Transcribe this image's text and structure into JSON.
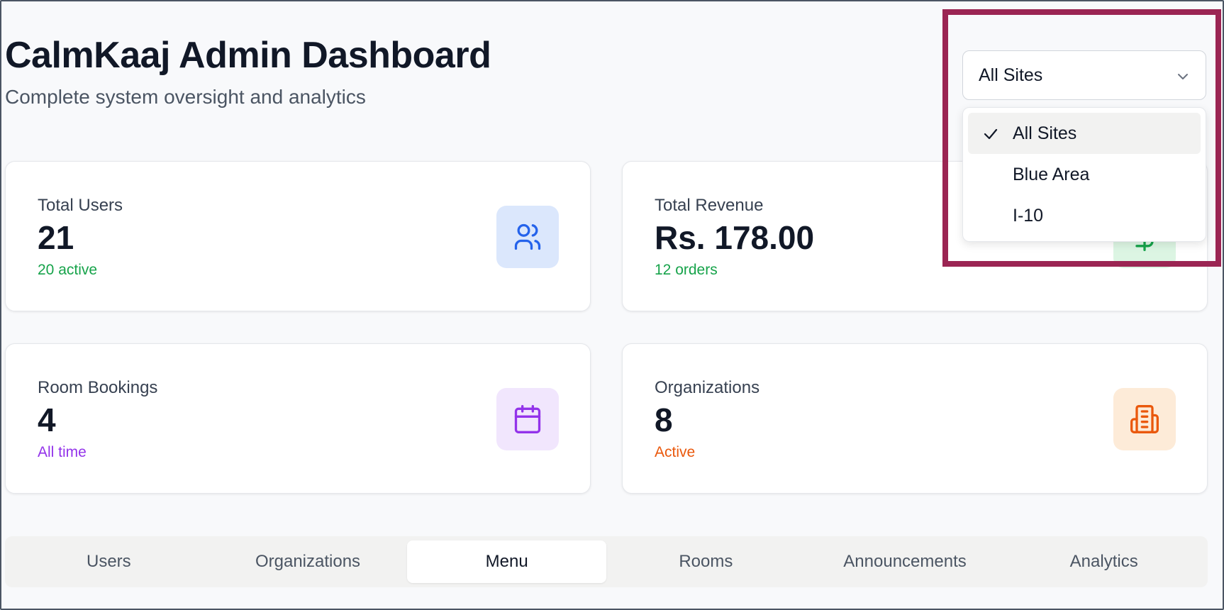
{
  "header": {
    "title": "CalmKaaj Admin Dashboard",
    "subtitle": "Complete system oversight and analytics"
  },
  "site_select": {
    "value": "All Sites",
    "options": [
      {
        "label": "All Sites",
        "selected": true
      },
      {
        "label": "Blue Area",
        "selected": false
      },
      {
        "label": "I-10",
        "selected": false
      }
    ]
  },
  "stats": {
    "users": {
      "label": "Total Users",
      "value": "21",
      "sub": "20 active",
      "sub_color": "#16a34a",
      "icon": "users-icon",
      "icon_bg": "#dbe7fc",
      "icon_color": "#2563eb"
    },
    "revenue": {
      "label": "Total Revenue",
      "value": "Rs. 178.00",
      "sub": "12 orders",
      "sub_color": "#16a34a",
      "icon": "dollar-icon",
      "icon_bg": "#dcf5e3",
      "icon_color": "#16a34a"
    },
    "bookings": {
      "label": "Room Bookings",
      "value": "4",
      "sub": "All time",
      "sub_color": "#9333ea",
      "icon": "calendar-icon",
      "icon_bg": "#f1e6fd",
      "icon_color": "#9333ea"
    },
    "orgs": {
      "label": "Organizations",
      "value": "8",
      "sub": "Active",
      "sub_color": "#ea580c",
      "icon": "building-icon",
      "icon_bg": "#fdebd8",
      "icon_color": "#ea580c"
    }
  },
  "tabs": [
    {
      "label": "Users",
      "active": false
    },
    {
      "label": "Organizations",
      "active": false
    },
    {
      "label": "Menu",
      "active": true
    },
    {
      "label": "Rooms",
      "active": false
    },
    {
      "label": "Announcements",
      "active": false
    },
    {
      "label": "Analytics",
      "active": false
    }
  ]
}
